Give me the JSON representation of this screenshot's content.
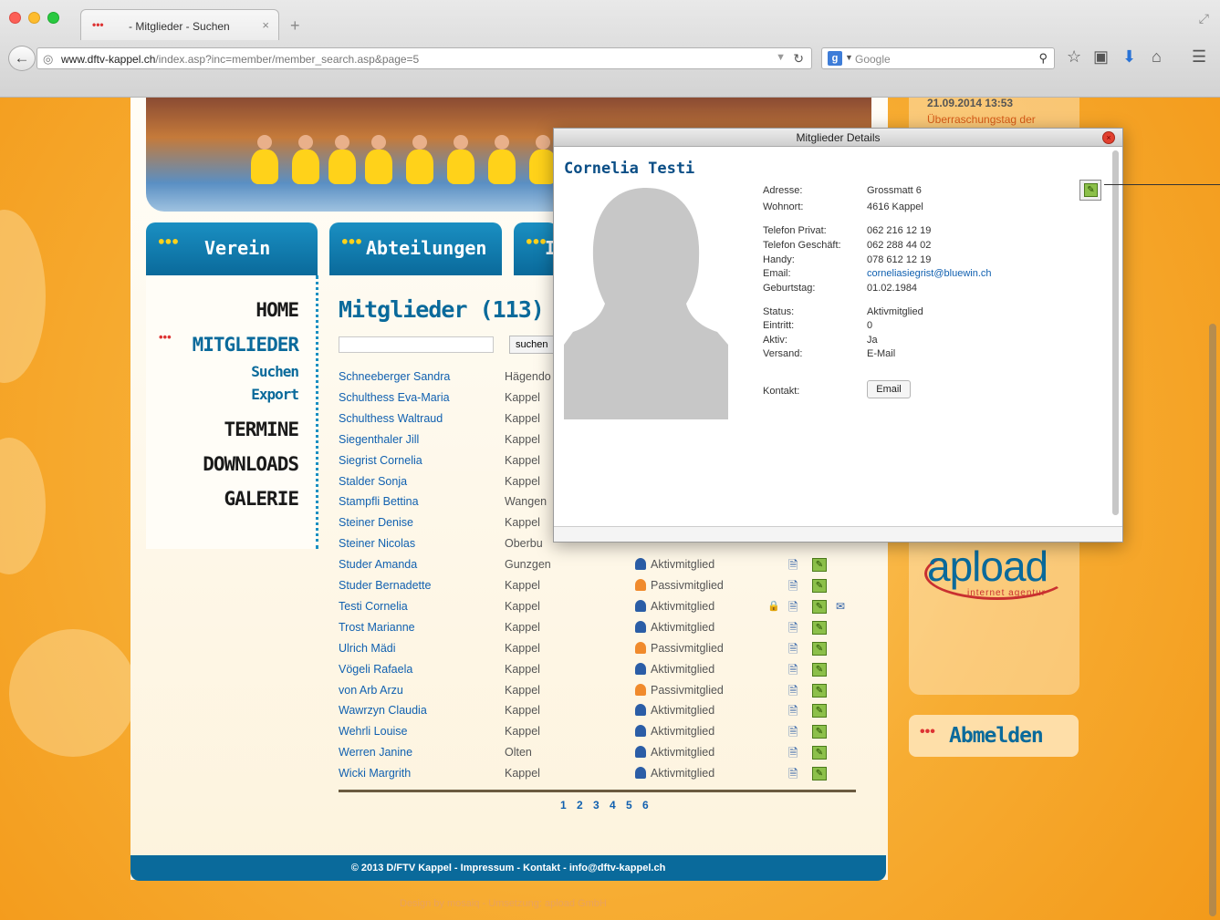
{
  "browser": {
    "tab_title": "- Mitglieder - Suchen",
    "tab_close": "×",
    "new_tab": "+",
    "url_domain": "www.dftv-kappel.ch",
    "url_path": "/index.asp?inc=member/member_search.asp&page=5",
    "search_placeholder": "Google"
  },
  "nav": {
    "tabs": [
      "Verein",
      "Abteilungen",
      "I"
    ],
    "side": {
      "home": "HOME",
      "mitglieder": "MITGLIEDER",
      "suchen": "Suchen",
      "export": "Export",
      "termine": "TERMINE",
      "downloads": "DOWNLOADS",
      "galerie": "GALERIE"
    }
  },
  "main": {
    "title": "Mitglieder (113)",
    "search_button": "suchen",
    "pager": "1 2 3 4 5 6",
    "members": [
      {
        "name": "Schneeberger Sandra",
        "town": "Hägendo",
        "status": ""
      },
      {
        "name": "Schulthess Eva-Maria",
        "town": "Kappel",
        "status": ""
      },
      {
        "name": "Schulthess Waltraud",
        "town": "Kappel",
        "status": ""
      },
      {
        "name": "Siegenthaler Jill",
        "town": "Kappel",
        "status": ""
      },
      {
        "name": "Siegrist Cornelia",
        "town": "Kappel",
        "status": ""
      },
      {
        "name": "Stalder Sonja",
        "town": "Kappel",
        "status": ""
      },
      {
        "name": "Stampfli Bettina",
        "town": "Wangen",
        "status": ""
      },
      {
        "name": "Steiner Denise",
        "town": "Kappel",
        "status": ""
      },
      {
        "name": "Steiner Nicolas",
        "town": "Oberbu",
        "status": ""
      },
      {
        "name": "Studer Amanda",
        "town": "Gunzgen",
        "status": "Aktivmitglied"
      },
      {
        "name": "Studer Bernadette",
        "town": "Kappel",
        "status": "Passivmitglied"
      },
      {
        "name": "Testi Cornelia",
        "town": "Kappel",
        "status": "Aktivmitglied"
      },
      {
        "name": "Trost Marianne",
        "town": "Kappel",
        "status": "Aktivmitglied"
      },
      {
        "name": "Ulrich Mädi",
        "town": "Kappel",
        "status": "Passivmitglied"
      },
      {
        "name": "Vögeli Rafaela",
        "town": "Kappel",
        "status": "Aktivmitglied"
      },
      {
        "name": "von Arb Arzu",
        "town": "Kappel",
        "status": "Passivmitglied"
      },
      {
        "name": "Wawrzyn Claudia",
        "town": "Kappel",
        "status": "Aktivmitglied"
      },
      {
        "name": "Wehrli Louise",
        "town": "Kappel",
        "status": "Aktivmitglied"
      },
      {
        "name": "Werren Janine",
        "town": "Olten",
        "status": "Aktivmitglied"
      },
      {
        "name": "Wicki Margrith",
        "town": "Kappel",
        "status": "Aktivmitglied"
      }
    ]
  },
  "footer": {
    "text": "© 2013 D/FTV Kappel - Impressum - Kontakt - info@dftv-kappel.ch",
    "credits": "Design by mosaiq - Umsetzung: apload GmbH"
  },
  "sidebar_right": {
    "news_date": "21.09.2014 13:53",
    "news_text": "Überraschungstag der",
    "logo_text": "apload",
    "logo_sub": "internet agentur",
    "logout": "Abmelden"
  },
  "modal": {
    "title": "Mitglieder Details",
    "name": "Cornelia Testi",
    "fields": [
      {
        "label": "Adresse:",
        "value": "Grossmatt 6"
      },
      {
        "label": "Wohnort:",
        "value": "4616 Kappel"
      },
      {
        "label": "Telefon Privat:",
        "value": "062 216 12 19"
      },
      {
        "label": "Telefon Geschäft:",
        "value": "062 288 44 02"
      },
      {
        "label": "Handy:",
        "value": "078 612 12 19"
      },
      {
        "label": "Email:",
        "value": "corneliasiegrist@bluewin.ch"
      },
      {
        "label": "Geburtstag:",
        "value": "01.02.1984"
      },
      {
        "label": "Status:",
        "value": "Aktivmitglied"
      },
      {
        "label": "Eintritt:",
        "value": "0"
      },
      {
        "label": "Aktiv:",
        "value": "Ja"
      },
      {
        "label": "Versand:",
        "value": "E-Mail"
      },
      {
        "label": "Kontakt:",
        "value": ""
      }
    ],
    "email_button": "Email"
  },
  "colors": {
    "brand_blue": "#0a6a9b",
    "link_blue": "#1060b0",
    "page_orange": "#f6a623",
    "aktiv_icon": "#2b5da6",
    "passiv_icon": "#f08a2c"
  }
}
